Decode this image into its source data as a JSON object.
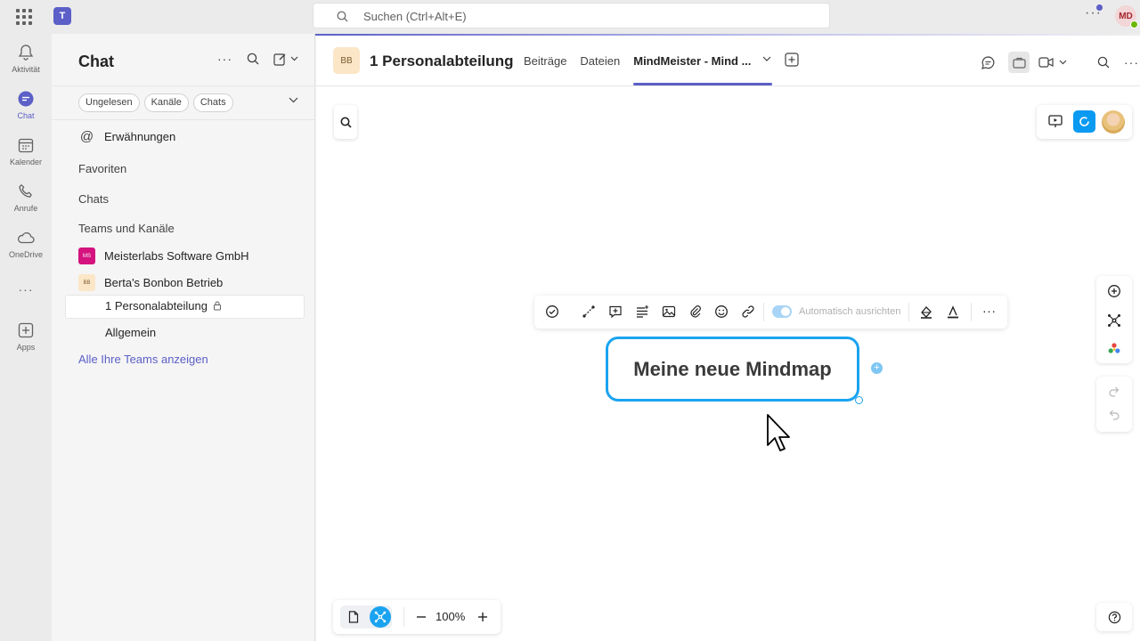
{
  "topbar": {
    "search_placeholder": "Suchen (Ctrl+Alt+E)",
    "more_label": "···",
    "user_initials": "MD"
  },
  "rail": {
    "items": [
      {
        "label": "Aktivität",
        "icon": "bell-icon"
      },
      {
        "label": "Chat",
        "icon": "chat-icon",
        "active": true
      },
      {
        "label": "Kalender",
        "icon": "calendar-icon"
      },
      {
        "label": "Anrufe",
        "icon": "phone-icon"
      },
      {
        "label": "OneDrive",
        "icon": "cloud-icon"
      },
      {
        "label": "···",
        "icon": "more-icon"
      },
      {
        "label": "Apps",
        "icon": "apps-add-icon"
      }
    ]
  },
  "panel": {
    "title": "Chat",
    "filters": [
      "Ungelesen",
      "Kanäle",
      "Chats"
    ],
    "mentions": "Erwähnungen",
    "favorites": "Favoriten",
    "chats": "Chats",
    "teams_section": "Teams und Kanäle",
    "teams": [
      {
        "name": "Meisterlabs Software GmbH",
        "initials": "MS",
        "color": "#d4137f"
      },
      {
        "name": "Berta's Bonbon Betrieb",
        "initials": "BB",
        "color": "#fbe6c7"
      }
    ],
    "channels": [
      "1 Personalabteilung",
      "Allgemein"
    ],
    "all_teams_link": "Alle Ihre Teams anzeigen"
  },
  "channel": {
    "avatar_initials": "BB",
    "title": "1 Personalabteilung",
    "tabs": [
      "Beiträge",
      "Dateien",
      "MindMeister - Mind ..."
    ],
    "active_tab": "MindMeister - Mind ..."
  },
  "mindmap": {
    "auto_align_label": "Automatisch ausrichten",
    "root_node": "Meine neue Mindmap",
    "zoom": "100%"
  },
  "colors": {
    "accent": "#5b5fc7",
    "mindmeister_blue": "#1aa3f0"
  }
}
